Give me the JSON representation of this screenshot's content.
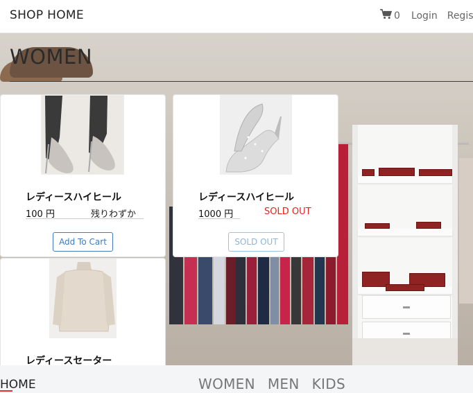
{
  "header": {
    "brand": "SHOP HOME",
    "cart_count": "0",
    "login_label": "Login",
    "register_label": "Regist"
  },
  "section": {
    "title": "WOMEN"
  },
  "products": [
    {
      "name": "レディースハイヒール",
      "price": "100 円",
      "stock_status": "残りわずか",
      "button_label": "Add To Cart",
      "stock_color": "#222222"
    },
    {
      "name": "レディースハイヒール",
      "price": "1000 円",
      "stock_status": "SOLD OUT",
      "button_label": "SOLD OUT",
      "stock_color": "#e8231e"
    },
    {
      "name": "レディースセーター"
    }
  ],
  "bottom_nav": {
    "home_label": "HOME",
    "categories": [
      "WOMEN",
      "MEN",
      "KIDS"
    ]
  },
  "colors": {
    "accent": "#3b7bbf",
    "sold_out": "#e8231e"
  }
}
